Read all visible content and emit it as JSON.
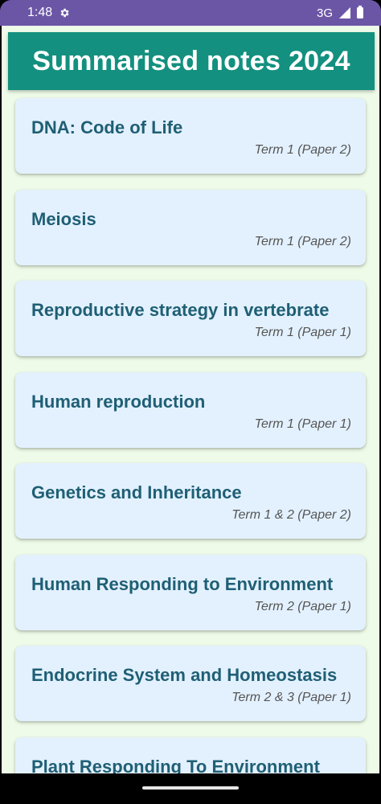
{
  "status_bar": {
    "time": "1:48",
    "network": "3G",
    "icons": [
      "gear-icon",
      "signal-icon",
      "battery-icon"
    ]
  },
  "app": {
    "title": "Summarised notes 2024",
    "colors": {
      "appbar": "#13907f",
      "card": "#e3f1ff",
      "title_text": "#1f5f74",
      "background": "#eefbe8"
    }
  },
  "notes": [
    {
      "title": "DNA: Code of Life",
      "subtitle": "Term 1 (Paper 2)"
    },
    {
      "title": "Meiosis",
      "subtitle": "Term 1 (Paper 2)"
    },
    {
      "title": "Reproductive strategy in vertebrate",
      "subtitle": "Term 1 (Paper 1)"
    },
    {
      "title": "Human reproduction",
      "subtitle": "Term 1 (Paper 1)"
    },
    {
      "title": "Genetics and Inheritance",
      "subtitle": "Term 1 & 2 (Paper 2)"
    },
    {
      "title": "Human Responding to Environment",
      "subtitle": "Term 2 (Paper 1)"
    },
    {
      "title": "Endocrine System and Homeostasis",
      "subtitle": "Term 2 & 3 (Paper 1)"
    },
    {
      "title": "Plant Responding To Environment",
      "subtitle": ""
    }
  ]
}
